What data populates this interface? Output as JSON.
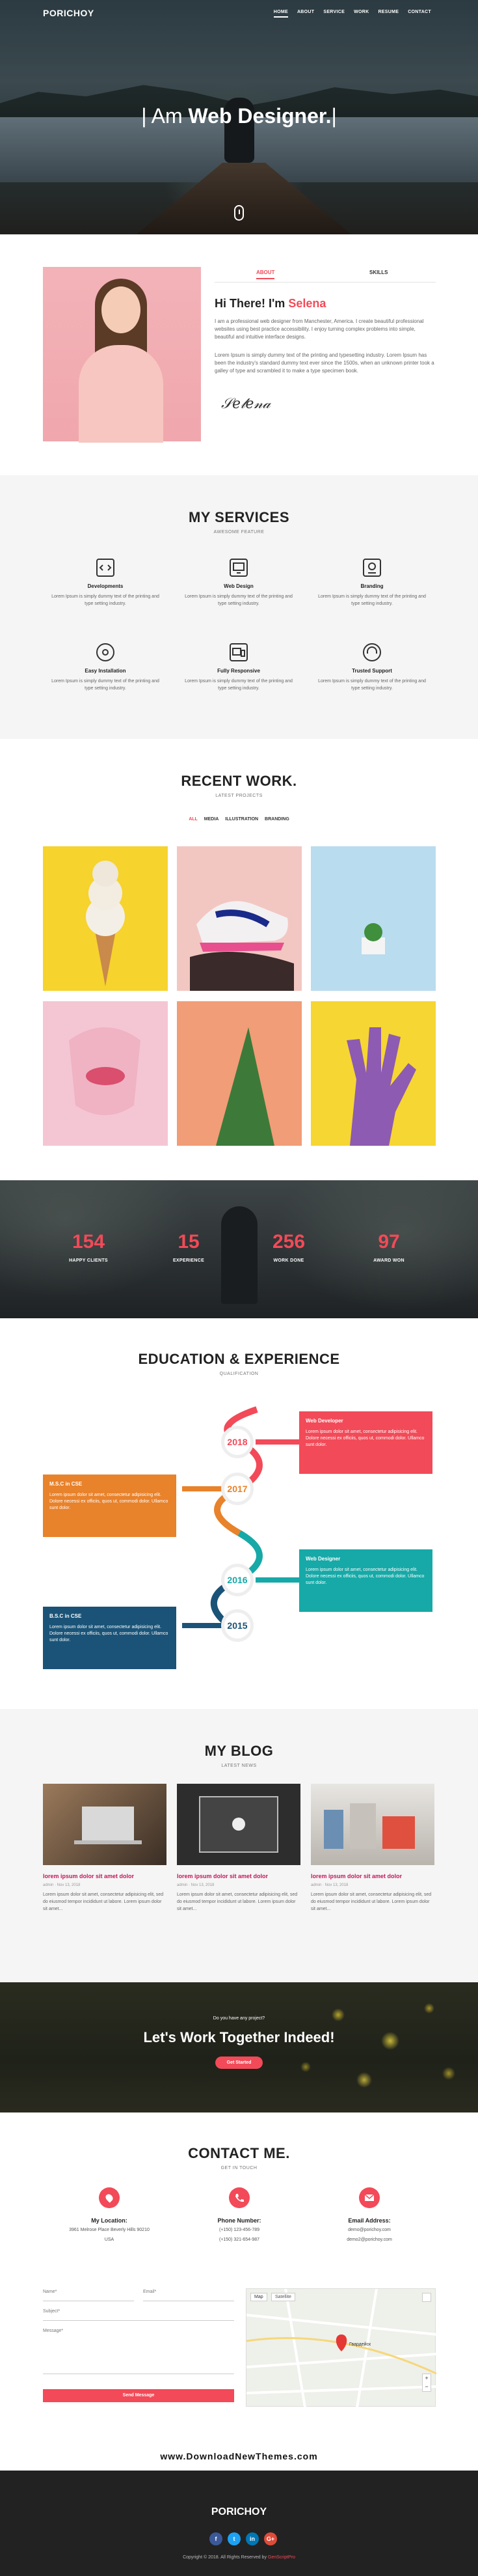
{
  "nav": {
    "logo": "PORICHOY",
    "items": [
      "HOME",
      "ABOUT",
      "SERVICE",
      "WORK",
      "RESUME",
      "CONTACT"
    ]
  },
  "hero": {
    "prefix": "| Am ",
    "highlight": "Web Designer.",
    "suffix": "|"
  },
  "about": {
    "tab_about": "ABOUT",
    "tab_skills": "SKILLS",
    "greeting": "Hi There! I'm ",
    "name": "Selena",
    "p1": "I am a professional web designer from Manchester, America. I create beautiful professional websites using best practice accessibility. I enjoy turning complex problems into simple, beautiful and intuitive interface designs.",
    "p2": "Lorem Ipsum is simply dummy text of the printing and typesetting industry. Lorem Ipsum has been the industry's standard dummy text ever since the 1500s, when an unknown printer took a galley of type and scrambled it to make a type specimen book.",
    "signature": "Selena"
  },
  "services": {
    "title": "MY SERVICES",
    "subtitle": "AWESOME FEATURE",
    "items": [
      {
        "icon": "code-icon",
        "title": "Developments",
        "desc": "Lorem Ipsum is simply dummy text of the printing and type setting industry."
      },
      {
        "icon": "monitor-icon",
        "title": "Web Design",
        "desc": "Lorem Ipsum is simply dummy text of the printing and type setting industry."
      },
      {
        "icon": "branding-icon",
        "title": "Branding",
        "desc": "Lorem Ipsum is simply dummy text of the printing and type setting industry."
      },
      {
        "icon": "gear-icon",
        "title": "Easy Installation",
        "desc": "Lorem Ipsum is simply dummy text of the printing and type setting industry."
      },
      {
        "icon": "responsive-icon",
        "title": "Fully Responsive",
        "desc": "Lorem Ipsum is simply dummy text of the printing and type setting industry."
      },
      {
        "icon": "support-icon",
        "title": "Trusted Support",
        "desc": "Lorem Ipsum is simply dummy text of the printing and type setting industry."
      }
    ]
  },
  "work": {
    "title": "RECENT WORK.",
    "subtitle": "LATEST PROJECTS",
    "filters": [
      "ALL",
      "MEDIA",
      "ILLUSTRATION",
      "BRANDING"
    ]
  },
  "counters": [
    {
      "value": "154",
      "label": "HAPPY CLIENTS"
    },
    {
      "value": "15",
      "label": "EXPERIENCE"
    },
    {
      "value": "256",
      "label": "WORK DONE"
    },
    {
      "value": "97",
      "label": "AWARD WON"
    }
  ],
  "education": {
    "title": "EDUCATION & EXPERIENCE",
    "subtitle": "QUALIFICATION",
    "items": [
      {
        "year": "2018",
        "title": "Web Developer",
        "desc": "Lorem ipsum dolor sit amet, consectetur adipisicing elit. Dolore necessi ex officiis, quos ut, commodi dolor. Ullamco sunt dolor."
      },
      {
        "year": "2017",
        "title": "M.S.C in CSE",
        "desc": "Lorem ipsum dolor sit amet, consectetur adipisicing elit. Dolore necessi ex officiis, quos ut, commodi dolor. Ullamco sunt dolor."
      },
      {
        "year": "2016",
        "title": "Web Designer",
        "desc": "Lorem ipsum dolor sit amet, consectetur adipisicing elit. Dolore necessi ex officiis, quos ut, commodi dolor. Ullamco sunt dolor."
      },
      {
        "year": "2015",
        "title": "B.S.C in CSE",
        "desc": "Lorem ipsum dolor sit amet, consectetur adipisicing elit. Dolore necessi ex officiis, quos ut, commodi dolor. Ullamco sunt dolor."
      }
    ],
    "colors": [
      "#f24a58",
      "#e8822b",
      "#16a9a7",
      "#1a5377"
    ]
  },
  "blog": {
    "title": "MY BLOG",
    "subtitle": "LATEST NEWS",
    "posts": [
      {
        "title": "lorem ipsum dolor sit amet dolor",
        "meta": "admin  ·  Nov 13, 2018",
        "desc": "Lorem ipsum dolor sit amet, consectetur adipisicing elit, sed do eiusmod tempor incididunt ut labore. Lorem ipsum dolor sit amet..."
      },
      {
        "title": "lorem ipsum dolor sit amet dolor",
        "meta": "admin  ·  Nov 13, 2018",
        "desc": "Lorem ipsum dolor sit amet, consectetur adipisicing elit, sed do eiusmod tempor incididunt ut labore. Lorem ipsum dolor sit amet..."
      },
      {
        "title": "lorem ipsum dolor sit amet dolor",
        "meta": "admin  ·  Nov 13, 2018",
        "desc": "Lorem ipsum dolor sit amet, consectetur adipisicing elit, sed do eiusmod tempor incididunt ut labore. Lorem ipsum dolor sit amet..."
      }
    ]
  },
  "cta": {
    "question": "Do you have any project?",
    "headline": "Let's Work Together Indeed!",
    "button": "Get Started"
  },
  "contact": {
    "title": "CONTACT ME.",
    "subtitle": "GET IN TOUCH",
    "items": [
      {
        "icon": "location-icon",
        "title": "My Location:",
        "line1": "3961 Melrose Place Beverly Hills 90210",
        "line2": "USA"
      },
      {
        "icon": "phone-icon",
        "title": "Phone Number:",
        "line1": "(+150) 123-456-789",
        "line2": "(+150) 321-654-987"
      },
      {
        "icon": "email-icon",
        "title": "Email Address:",
        "line1": "demo@porichoy.com",
        "line2": "demo2@porichoy.com"
      }
    ],
    "name_placeholder": "Name*",
    "email_placeholder": "Email*",
    "subject_placeholder": "Subject*",
    "message_placeholder": "Message*",
    "send": "Send Message",
    "map_tab1": "Map",
    "map_tab2": "Satellite",
    "map_label": "Гвардейск"
  },
  "watermark": "www.DownloadNewThemes.com",
  "footer": {
    "logo": "PORICHOY",
    "social": [
      "f",
      "t",
      "in",
      "G+"
    ],
    "copyright_prefix": "Copyright © 2018. All Rights Reserved by ",
    "copyright_brand": "GenScriptPro",
    "social_colors": [
      "#3b5998",
      "#1da1f2",
      "#0077b5",
      "#dd4b39"
    ]
  }
}
